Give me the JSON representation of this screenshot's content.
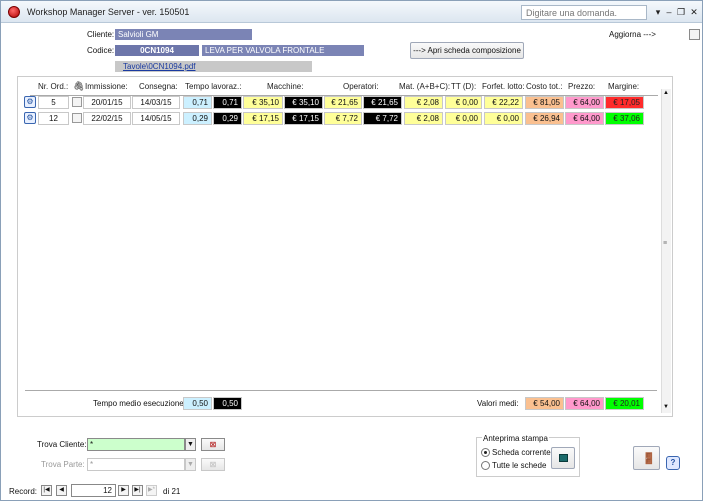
{
  "window": {
    "title": "Workshop Manager Server - ver. 150501",
    "help_placeholder": "Digitare una domanda."
  },
  "header": {
    "cliente_label": "Cliente:",
    "cliente_value": "Salvioli GM",
    "codice_label": "Codice:",
    "codice_value": "0CN1094",
    "descrizione_value": "LEVA PER VALVOLA FRONTALE",
    "file_link": "Tavole\\0CN1094.pdf",
    "open_button": "---> Apri scheda composizione",
    "aggiorna_label": "Aggiorna --->"
  },
  "table": {
    "headers": [
      "Nr. Ord.:",
      "Immissione:",
      "Consegna:",
      "Tempo lavoraz.:",
      "Macchine:",
      "Operatori:",
      "Mat. (A+B+C):",
      "TT (D):",
      "Forfet. lotto:",
      "Costo tot.:",
      "Prezzo:",
      "Margine:"
    ],
    "rows": [
      {
        "nr": "5",
        "immissione": "20/01/15",
        "consegna": "14/03/15",
        "tempo1": "0,71",
        "tempo2": "0,71",
        "macchine1": "€ 35,10",
        "macchine2": "€ 35,10",
        "operatori1": "€ 21,65",
        "operatori2": "€ 21,65",
        "mat": "€ 2,08",
        "tt": "€ 0,00",
        "forfet": "€ 22,22",
        "costo": "€ 81,05",
        "prezzo": "€ 64,00",
        "margine": "€ 17,05",
        "margine_status": "negative"
      },
      {
        "nr": "12",
        "immissione": "22/02/15",
        "consegna": "14/05/15",
        "tempo1": "0,29",
        "tempo2": "0,29",
        "macchine1": "€ 17,15",
        "macchine2": "€ 17,15",
        "operatori1": "€ 7,72",
        "operatori2": "€ 7,72",
        "mat": "€ 2,08",
        "tt": "€ 0,00",
        "forfet": "€ 0,00",
        "costo": "€ 26,94",
        "prezzo": "€ 64,00",
        "margine": "€ 37,06",
        "margine_status": "positive"
      }
    ]
  },
  "footer": {
    "tempo_medio_label": "Tempo medio esecuzione:",
    "tempo_medio_1": "0,50",
    "tempo_medio_2": "0,50",
    "valori_medi_label": "Valori medi:",
    "medio_costo": "€ 54,00",
    "medio_prezzo": "€ 64,00",
    "medio_margine": "€ 20,01"
  },
  "search": {
    "trova_cliente_label": "Trova Cliente:",
    "trova_cliente_value": "*",
    "trova_parte_label": "Trova Parte:",
    "trova_parte_value": "*"
  },
  "print": {
    "title": "Anteprima stampa",
    "option1": "Scheda corrente",
    "option2": "Tutte le schede",
    "selected": "Scheda corrente"
  },
  "navigation": {
    "record_label": "Record:",
    "current": "12",
    "of_label": "di 21"
  },
  "colors": {
    "blue_field": "#7b84b5",
    "cyan": "#ccf0ff",
    "yellow": "#ffff99",
    "peach": "#fac090",
    "pink": "#ff99cc",
    "negative": "#ff2b2b",
    "positive": "#00ff00"
  }
}
